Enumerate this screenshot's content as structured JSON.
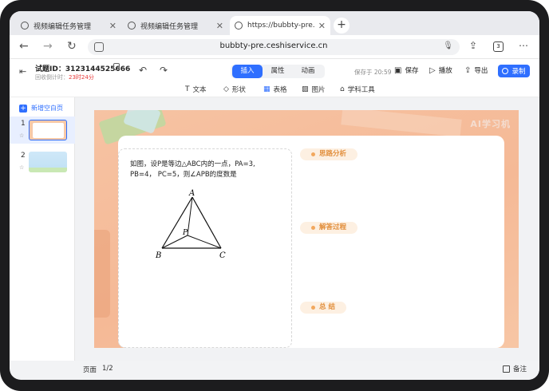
{
  "browser": {
    "tabs": [
      {
        "title": "视频编辑任务管理",
        "active": false
      },
      {
        "title": "视频编辑任务管理",
        "active": false
      },
      {
        "title": "https://bubbty-pre.ceshiservice.cn",
        "active": true
      }
    ],
    "url": "bubbty-pre.ceshiservice.cn",
    "tab_count": "3"
  },
  "header": {
    "question_id": "试题ID：3123144525666",
    "countdown_label": "回收倒计时：",
    "countdown_value": "23时24分",
    "modes": [
      "插入",
      "属性",
      "动画"
    ],
    "active_mode": "插入",
    "saved_at": "保存于 20:59",
    "save_label": "保存",
    "play_label": "播放",
    "export_label": "导出",
    "record_label": "录制"
  },
  "toolbar": {
    "text_label": "文本",
    "shape_label": "形状",
    "table_label": "表格",
    "image_label": "图片",
    "tools_label": "学科工具"
  },
  "sidebar": {
    "add_page_label": "新增空白页",
    "pages": [
      {
        "number": "1",
        "active": true
      },
      {
        "number": "2",
        "active": false
      }
    ]
  },
  "slide": {
    "brand": "AI学习机",
    "question_line1": "如图，设P是等边△ABC内的一点，PA=3,",
    "question_line2": "PB=4， PC=5，则∠APB的度数是",
    "figure_labels": {
      "a": "A",
      "b": "B",
      "c": "C",
      "p": "P"
    },
    "sections": [
      "思路分析",
      "解答过程",
      "总  结"
    ]
  },
  "statusbar": {
    "page_label": "页面",
    "page_count": "1/2",
    "notes_label": "备注"
  },
  "colors": {
    "accent": "#2f6fff",
    "countdown": "#e83a3a",
    "section_bg": "#fdf0e2",
    "section_text": "#e28f3d",
    "slide_bg": "#f6c3a3"
  }
}
